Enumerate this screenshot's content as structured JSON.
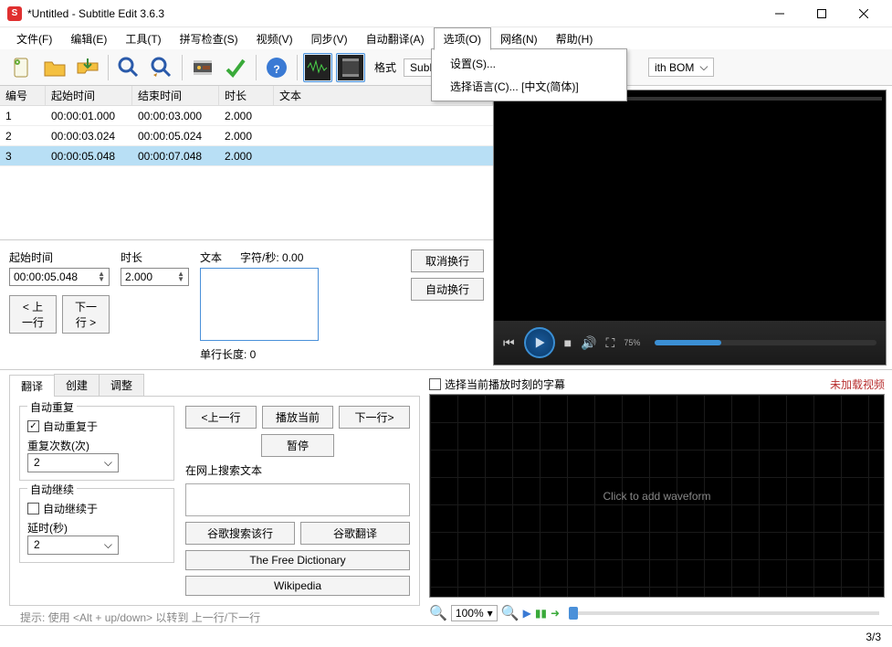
{
  "title": "*Untitled - Subtitle Edit 3.6.3",
  "menu": {
    "file": "文件(F)",
    "edit": "编辑(E)",
    "tools": "工具(T)",
    "spell": "拼写检查(S)",
    "video": "视频(V)",
    "sync": "同步(V)",
    "auto": "自动翻译(A)",
    "options": "选项(O)",
    "network": "网络(N)",
    "help": "帮助(H)"
  },
  "dropdown": {
    "settings": "设置(S)...",
    "language": "选择语言(C)... [中文(简体)]"
  },
  "format": {
    "label": "格式",
    "value": "SubRip",
    "encoding": "ith BOM"
  },
  "grid": {
    "headers": {
      "num": "编号",
      "start": "起始时间",
      "end": "结束时间",
      "dur": "时长",
      "text": "文本"
    },
    "rows": [
      {
        "num": "1",
        "start": "00:00:01.000",
        "end": "00:00:03.000",
        "dur": "2.000",
        "text": ""
      },
      {
        "num": "2",
        "start": "00:00:03.024",
        "end": "00:00:05.024",
        "dur": "2.000",
        "text": ""
      },
      {
        "num": "3",
        "start": "00:00:05.048",
        "end": "00:00:07.048",
        "dur": "2.000",
        "text": ""
      }
    ]
  },
  "editor": {
    "start_label": "起始时间",
    "dur_label": "时长",
    "text_label": "文本",
    "cps_label": "字符/秒: 0.00",
    "start_val": "00:00:05.048",
    "dur_val": "2.000",
    "prev": "< 上一行",
    "next": "下一行 >",
    "cancel_wrap": "取消换行",
    "auto_wrap": "自动换行",
    "line_len": "单行长度: 0"
  },
  "tabs": {
    "translate": "翻译",
    "create": "创建",
    "adjust": "调整"
  },
  "translate": {
    "auto_repeat": "自动重复",
    "auto_repeat_on": "自动重复于",
    "repeat_count": "重复次数(次)",
    "repeat_val": "2",
    "auto_continue": "自动继续",
    "auto_continue_on": "自动继续于",
    "delay": "延时(秒)",
    "delay_val": "2",
    "prev": "<上一行",
    "play_cur": "播放当前",
    "next": "下一行>",
    "pause": "暂停",
    "search_web": "在网上搜索文本",
    "google_line": "谷歌搜索该行",
    "google_tr": "谷歌翻译",
    "freedict": "The Free Dictionary",
    "wikipedia": "Wikipedia"
  },
  "hint": "提示: 使用 <Alt + up/down> 以转到 上一行/下一行",
  "wave": {
    "select_current": "选择当前播放时刻的字幕",
    "not_loaded": "未加载视频",
    "click_add": "Click to add waveform",
    "zoom": "100%"
  },
  "status": "3/3"
}
